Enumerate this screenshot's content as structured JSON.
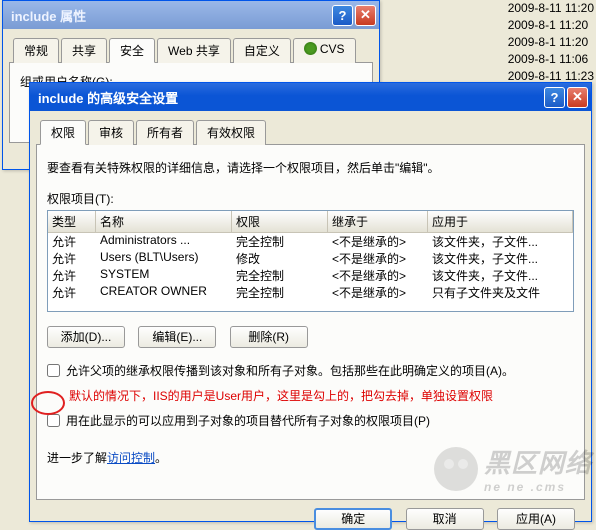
{
  "bg_dates": [
    "2009-8-11 11:20",
    "2009-8-1 11:20",
    "2009-8-1 11:20",
    "2009-8-1 11:06",
    "2009-8-11 11:23"
  ],
  "win1": {
    "title": "include 属性",
    "tabs": [
      "常规",
      "共享",
      "安全",
      "Web 共享",
      "自定义",
      "CVS"
    ],
    "row1_label": "组或用户名称(G):"
  },
  "win2": {
    "title": "include 的高级安全设置",
    "tabs": [
      "权限",
      "审核",
      "所有者",
      "有效权限"
    ],
    "intro": "要查看有关特殊权限的详细信息，请选择一个权限项目，然后单击\"编辑\"。",
    "list_label": "权限项目(T):",
    "cols": [
      "类型",
      "名称",
      "权限",
      "继承于",
      "应用于"
    ],
    "rows": [
      [
        "允许",
        "Administrators ...",
        "完全控制",
        "<不是继承的>",
        "该文件夹，子文件..."
      ],
      [
        "允许",
        "Users (BLT\\Users)",
        "修改",
        "<不是继承的>",
        "该文件夹，子文件..."
      ],
      [
        "允许",
        "SYSTEM",
        "完全控制",
        "<不是继承的>",
        "该文件夹，子文件..."
      ],
      [
        "允许",
        "CREATOR OWNER",
        "完全控制",
        "<不是继承的>",
        "只有子文件夹及文件"
      ]
    ],
    "btn_add": "添加(D)...",
    "btn_edit": "编辑(E)...",
    "btn_remove": "删除(R)",
    "chk1": "允许父项的继承权限传播到该对象和所有子对象。包括那些在此明确定义的项目(A)。",
    "red_note": "默认的情况下，IIS的用户是User用户，这里是勾上的，把勾去掉，单独设置权限",
    "chk2": "用在此显示的可以应用到子对象的项目替代所有子对象的权限项目(P)",
    "more_a": "进一步了解",
    "more_b": "访问控制",
    "ok": "确定",
    "cancel": "取消",
    "apply": "应用(A)"
  },
  "watermark_a": "黑区网络",
  "watermark_b": "ne ne .cms"
}
